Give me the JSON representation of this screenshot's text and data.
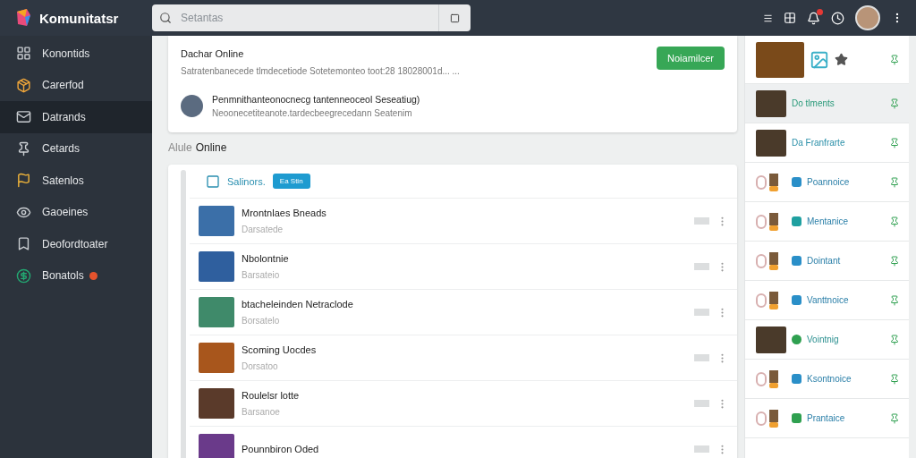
{
  "app": {
    "title": "Komunitatsr"
  },
  "search": {
    "placeholder": "Setantas"
  },
  "topbar": {
    "notification_badge": true
  },
  "sidebar": {
    "items": [
      {
        "label": "Konontids",
        "selected": false,
        "badge": false
      },
      {
        "label": "Carerfod",
        "selected": false,
        "badge": false
      },
      {
        "label": "Datrands",
        "selected": true,
        "badge": false
      },
      {
        "label": "Cetards",
        "selected": false,
        "badge": false
      },
      {
        "label": "Satenlos",
        "selected": false,
        "badge": false
      },
      {
        "label": "Gaoeines",
        "selected": false,
        "badge": false
      },
      {
        "label": "Deofordtoater",
        "selected": false,
        "badge": false
      },
      {
        "label": "Bonatols",
        "selected": false,
        "badge": true
      }
    ]
  },
  "featured": {
    "title": "Dachar Online",
    "description": "Satratenbanecede tlmdecetiode Sotetemonteo toot:28 18028001d... ...",
    "button": "Noiamilcer",
    "post": {
      "title": "Penmnithanteonocnecg tantenneoceol Seseatiug)",
      "subtitle": "Neoonecetiteanote.tardecbeegrecedann Seatenim"
    }
  },
  "section": {
    "prefix": "Alule",
    "title": "Online"
  },
  "list": {
    "header": "Salinors.",
    "badge": "Ea Stin",
    "rows": [
      {
        "title": "Mrontnlaes Bneads",
        "subtitle": "Darsatede",
        "color": "#3b6fa8"
      },
      {
        "title": "Nbolontnie",
        "subtitle": "Barsateio",
        "color": "#2f5f9e"
      },
      {
        "title": "btacheleinden Netraclode",
        "subtitle": "Borsatelo",
        "color": "#3f8a6a"
      },
      {
        "title": "Scoming Uocdes",
        "subtitle": "Dorsatoo",
        "color": "#a8561c"
      },
      {
        "title": "Roulelsr lotte",
        "subtitle": "Barsanoe",
        "color": "#5a3a2a"
      },
      {
        "title": "Pounnbiron Oded",
        "color": "#6a3a8a"
      }
    ]
  },
  "panel": {
    "rows": [
      {
        "kind": "hero",
        "selected": false,
        "color": "#7a4a1a"
      },
      {
        "kind": "thumb",
        "label": "Do tlments",
        "selected": true,
        "color": "#2a9a7a"
      },
      {
        "kind": "thumb",
        "label": "Da Franfrarte",
        "selected": false,
        "color": "#2a8fa8"
      },
      {
        "kind": "pair",
        "label": "Poannoice",
        "selected": false,
        "color": "#2a8fc8"
      },
      {
        "kind": "pair",
        "label": "Mentanice",
        "selected": false,
        "color": "#1fa0a0"
      },
      {
        "kind": "pair",
        "label": "Dointant",
        "selected": false,
        "color": "#2a8fc8"
      },
      {
        "kind": "pair",
        "label": "Vanttnoice",
        "selected": false,
        "color": "#2a8fc8"
      },
      {
        "kind": "thumbdot",
        "label": "Vointnig",
        "selected": false,
        "color": "#2fa050"
      },
      {
        "kind": "pair",
        "label": "Ksontnoice",
        "selected": false,
        "color": "#2a8fc8"
      },
      {
        "kind": "pair",
        "label": "Prantaice",
        "selected": false,
        "color": "#2fa050"
      }
    ]
  }
}
